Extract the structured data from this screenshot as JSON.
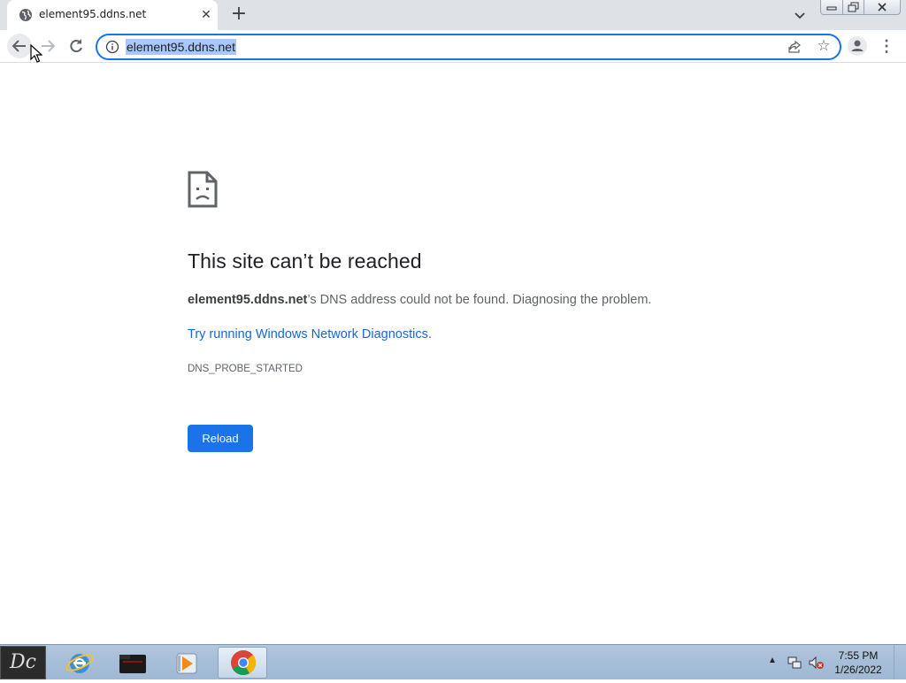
{
  "browser": {
    "tab": {
      "title": "element95.ddns.net",
      "favicon": "globe-icon",
      "close_glyph": "✕"
    },
    "new_tab_glyph": "+",
    "address_bar": {
      "url": "element95.ddns.net",
      "info_icon": "info-icon"
    },
    "star_glyph": "☆",
    "menu_glyph": "⋮"
  },
  "error_page": {
    "title": "This site can’t be reached",
    "host": "element95.ddns.net",
    "description": "’s DNS address could not be found. Diagnosing the problem.",
    "diagnostics_link": "Try running Windows Network Diagnostics",
    "diagnostics_suffix": ".",
    "error_code": "DNS_PROBE_STARTED",
    "reload_label": "Reload"
  },
  "taskbar": {
    "start_label": "Dc",
    "apps": [
      "internet-explorer-icon",
      "file-explorer-icon",
      "media-player-icon",
      "chrome-icon"
    ],
    "tray_arrow": "▲",
    "time": "7:55 PM",
    "date": "1/26/2022"
  },
  "colors": {
    "accent": "#1a73e8",
    "link": "#1967d2",
    "selection": "#a8c7fa"
  }
}
